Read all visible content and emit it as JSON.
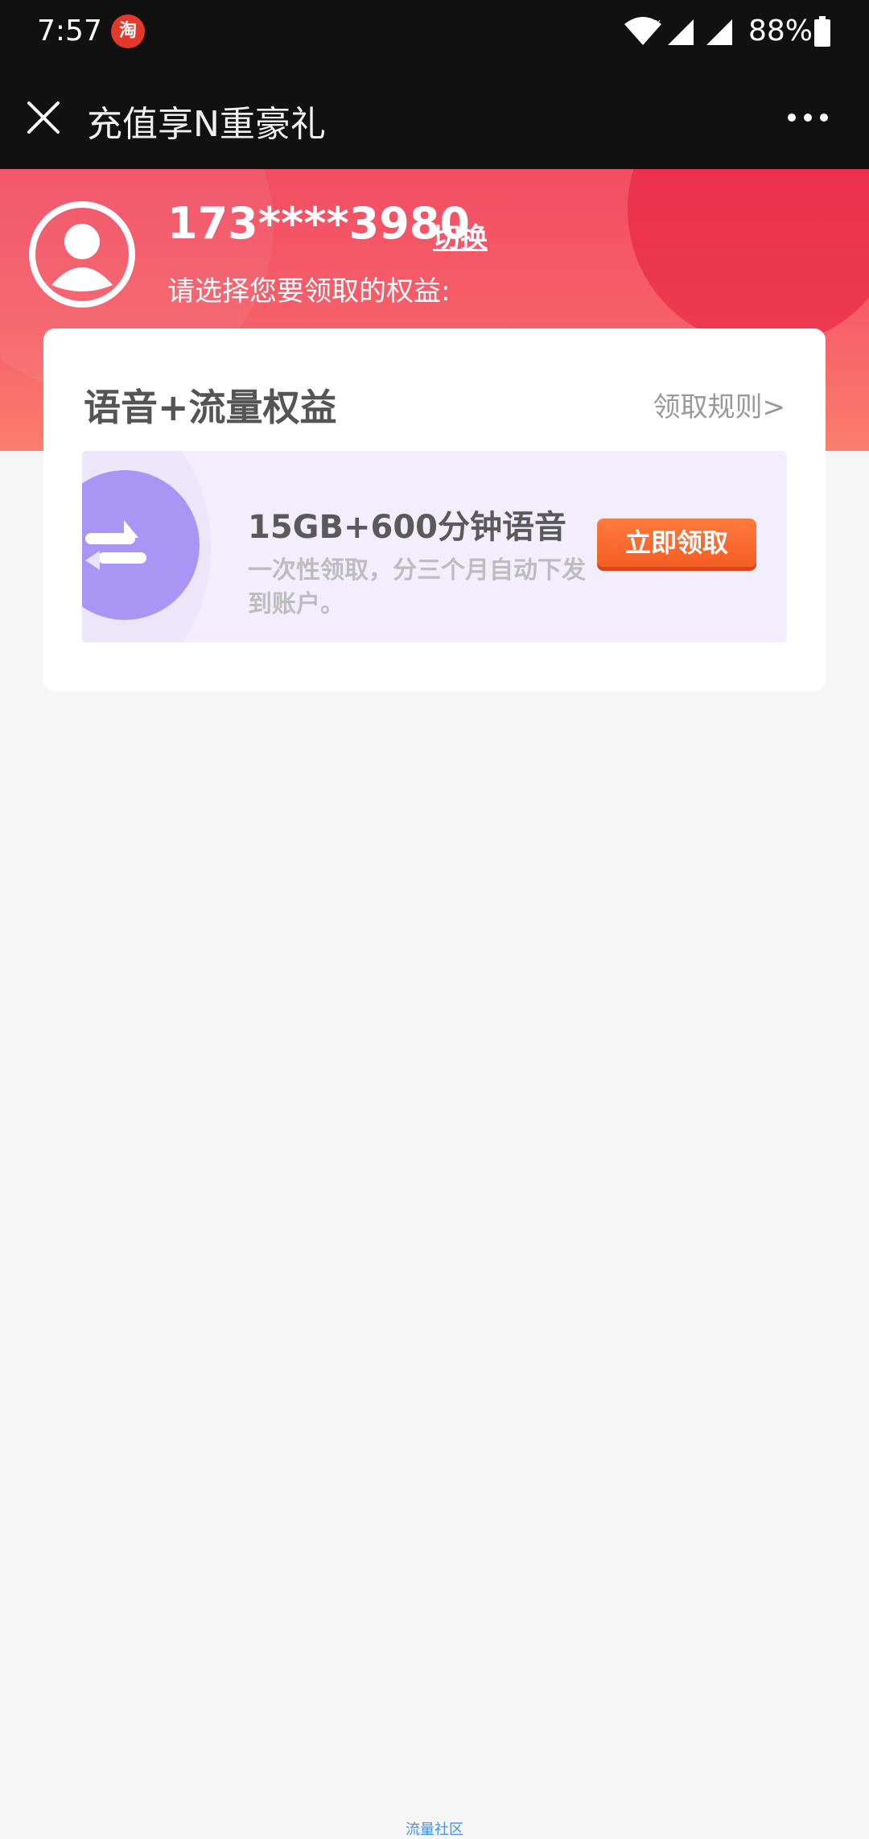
{
  "status_bar": {
    "time": "7:57",
    "app_icon_text": "淘",
    "battery_percent": "88%",
    "icons": [
      "taobao-icon",
      "wifi-icon",
      "cell-signal-icon",
      "cell-signal-icon",
      "battery-icon"
    ]
  },
  "title_bar": {
    "title": "充值享N重豪礼",
    "icons": [
      "close-icon",
      "more-icon"
    ]
  },
  "header": {
    "phone": "173****3980",
    "switch_label": "切换",
    "subtitle": "请选择您要领取的权益:"
  },
  "card": {
    "title": "语音+流量权益",
    "rules_label": "领取规则>",
    "benefit": {
      "title": "15GB+600分钟语音",
      "description": "一次性领取，分三个月自动下发到账户。",
      "button_label": "立即领取"
    }
  },
  "footer": {
    "text": "流量社区"
  },
  "colors": {
    "header_red": "#f14d63",
    "button_orange": "#f45d23",
    "benefit_purple": "#a995f4",
    "background": "#f6f6f6"
  }
}
